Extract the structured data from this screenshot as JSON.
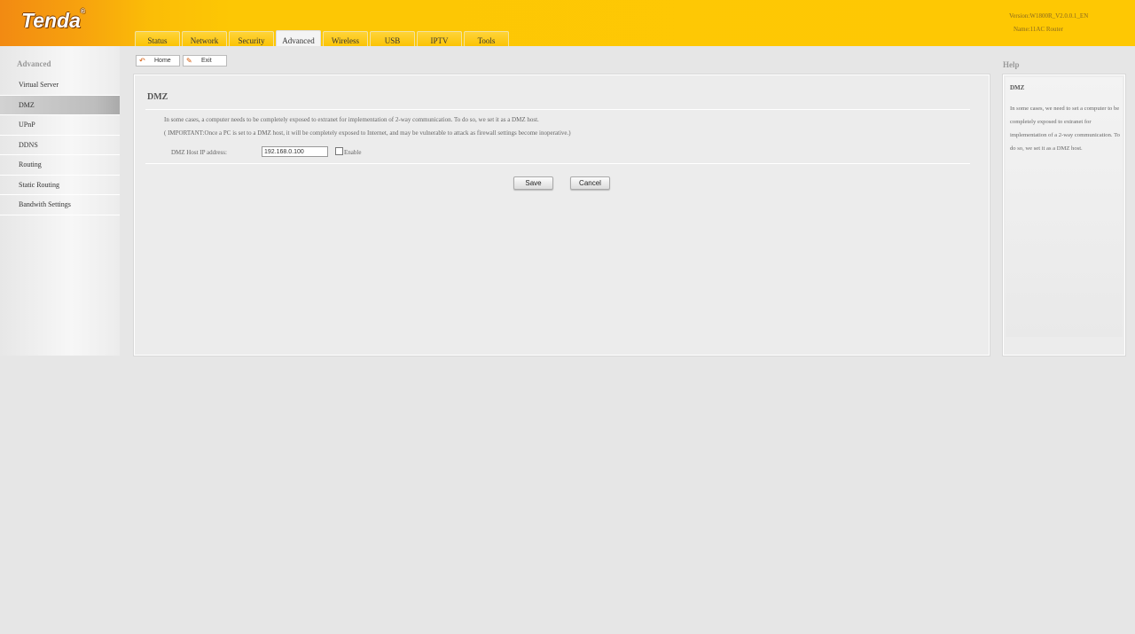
{
  "header": {
    "logo": "Tenda",
    "logo_mark": "®",
    "version": "Version:W1800R_V2.0.0.1_EN",
    "name": "Name:11AC Router",
    "tabs": [
      {
        "label": "Status"
      },
      {
        "label": "Network"
      },
      {
        "label": "Security"
      },
      {
        "label": "Advanced"
      },
      {
        "label": "Wireless"
      },
      {
        "label": "USB"
      },
      {
        "label": "IPTV"
      },
      {
        "label": "Tools"
      }
    ],
    "active_tab": "Advanced"
  },
  "sidebar": {
    "title": "Advanced",
    "items": [
      {
        "label": "Virtual Server"
      },
      {
        "label": "DMZ"
      },
      {
        "label": "UPnP"
      },
      {
        "label": "DDNS"
      },
      {
        "label": "Routing"
      },
      {
        "label": "Static Routing"
      },
      {
        "label": "Bandwith Settings"
      }
    ],
    "active_item": "DMZ"
  },
  "toolbar": {
    "home_label": "Home",
    "exit_label": "Exit",
    "home_icon": "home-icon",
    "exit_icon": "exit-icon"
  },
  "main": {
    "title": "DMZ",
    "description": "In some cases, a computer needs to be completely exposed to extranet for implementation of 2-way communication. To do so, we set it as a DMZ host.",
    "important": "( IMPORTANT:Once a PC is set to a DMZ host, it will be completely exposed to Internet, and may be vulnerable to attack as firewall settings become inoperative.)",
    "host_ip_label": "DMZ Host IP address:",
    "host_ip_value": "192.168.0.100",
    "enable_label": "Enable",
    "enable_checked": false,
    "save_label": "Save",
    "cancel_label": "Cancel"
  },
  "help": {
    "title": "Help",
    "heading": "DMZ",
    "text": "In some cases, we need to set a computer to be completely exposed to extranet for implementation of a 2-way communication. To do so, we set it as a DMZ host."
  },
  "colors": {
    "header_left": "#f28a12",
    "header_right": "#fec803",
    "active_sidebar": "#bdbdbd",
    "page_bg": "#e6e6e6"
  }
}
